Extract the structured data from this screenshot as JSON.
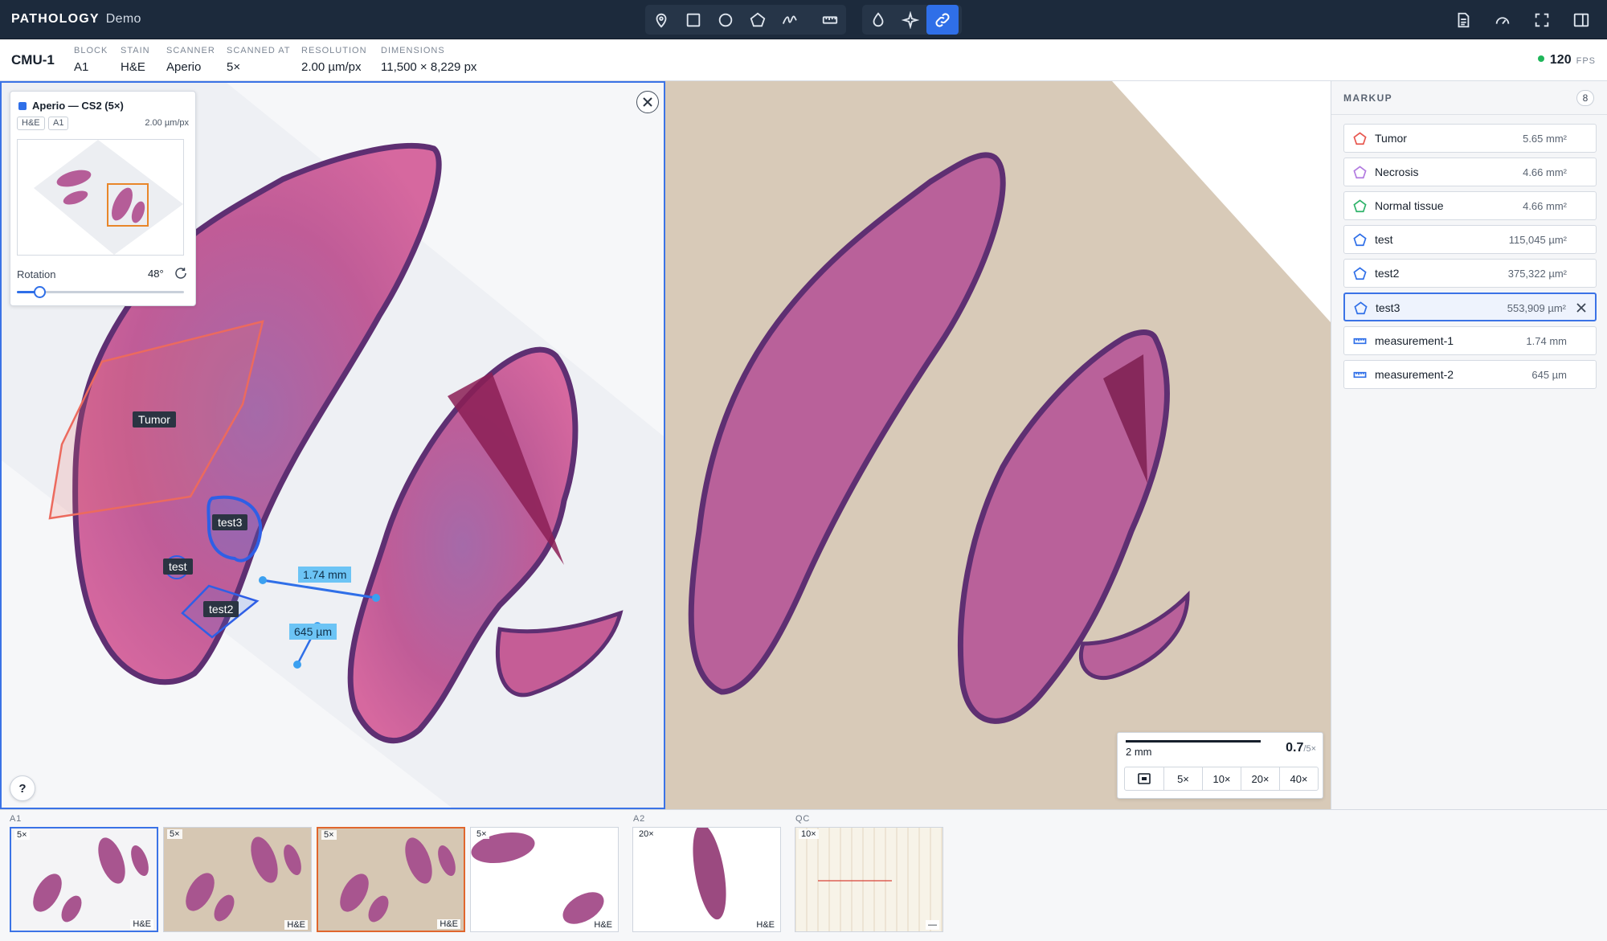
{
  "app": {
    "brand": "PATHOLOGY",
    "mode": "Demo"
  },
  "toolbar": {
    "tools": [
      {
        "name": "pin-tool",
        "icon": "map-pin-icon"
      },
      {
        "name": "rectangle-tool",
        "icon": "square-icon"
      },
      {
        "name": "ellipse-tool",
        "icon": "circle-icon"
      },
      {
        "name": "polygon-tool",
        "icon": "pentagon-icon"
      },
      {
        "name": "freehand-tool",
        "icon": "freehand-icon"
      },
      {
        "name": "ruler-tool",
        "icon": "ruler-icon"
      },
      {
        "name": "stain-tool",
        "icon": "droplet-icon"
      },
      {
        "name": "ai-tool",
        "icon": "sparkle-icon"
      },
      {
        "name": "link-tool",
        "icon": "link-icon",
        "active": true
      }
    ],
    "right": [
      "report-icon",
      "gauge-icon",
      "fullscreen-icon",
      "sidebar-icon"
    ]
  },
  "slide": {
    "id": "CMU-1",
    "meta": [
      {
        "key": "BLOCK",
        "value": "A1"
      },
      {
        "key": "STAIN",
        "value": "H&E"
      },
      {
        "key": "SCANNER",
        "value": "Aperio"
      },
      {
        "key": "SCANNED AT",
        "value": "5×"
      },
      {
        "key": "RESOLUTION",
        "value": "2.00 µm/px"
      },
      {
        "key": "DIMENSIONS",
        "value": "11,500 × 8,229 px"
      }
    ]
  },
  "fps": {
    "value": "120",
    "unit": "FPS"
  },
  "slide_panel": {
    "title": "Aperio — CS2 (5×)",
    "chips": [
      "H&E",
      "A1"
    ],
    "resolution": "2.00 µm/px",
    "rotation_label": "Rotation",
    "rotation_value": "48°",
    "rotation_fraction": 0.133
  },
  "annotations": {
    "tumor": "Tumor",
    "test3": "test3",
    "test": "test",
    "test2": "test2",
    "meas1": "1.74 mm",
    "meas2": "645 µm"
  },
  "help_label": "?",
  "scalebar": {
    "length": "2 mm",
    "magnification": "0.7",
    "native": "/5×",
    "zoom_buttons": [
      "5×",
      "10×",
      "20×",
      "40×"
    ]
  },
  "markup": {
    "title": "MARKUP",
    "count": "8",
    "items": [
      {
        "name": "Tumor",
        "value": "5.65 mm²",
        "icon": "polygon-icon",
        "color": "#e8574f"
      },
      {
        "name": "Necrosis",
        "value": "4.66 mm²",
        "icon": "polygon-icon",
        "color": "#b27be0"
      },
      {
        "name": "Normal tissue",
        "value": "4.66 mm²",
        "icon": "polygon-icon",
        "color": "#2fb36a"
      },
      {
        "name": "test",
        "value": "115,045 µm²",
        "icon": "polygon-icon",
        "color": "#2f6fe8"
      },
      {
        "name": "test2",
        "value": "375,322 µm²",
        "icon": "polygon-icon",
        "color": "#2f6fe8"
      },
      {
        "name": "test3",
        "value": "553,909 µm²",
        "icon": "polygon-icon",
        "color": "#2f6fe8",
        "selected": true
      },
      {
        "name": "measurement-1",
        "value": "1.74 mm",
        "icon": "ruler-icon",
        "color": "#2f6fe8"
      },
      {
        "name": "measurement-2",
        "value": "645 µm",
        "icon": "ruler-icon",
        "color": "#2f6fe8"
      }
    ]
  },
  "filmstrip": {
    "groups": [
      "A1",
      "A2",
      "QC"
    ],
    "thumbs": [
      {
        "mag": "5×",
        "stain": "H&E",
        "state": "selected"
      },
      {
        "mag": "5×",
        "stain": "H&E",
        "state": ""
      },
      {
        "mag": "5×",
        "stain": "H&E",
        "state": "active-orange"
      },
      {
        "mag": "5×",
        "stain": "H&E",
        "state": ""
      },
      {
        "mag": "20×",
        "stain": "H&E",
        "state": ""
      },
      {
        "mag": "10×",
        "stain": "—",
        "state": ""
      }
    ]
  },
  "colors": {
    "accent": "#2f6fe8",
    "topbar": "#1c2a3c",
    "tissue": "#c2538f",
    "tissue_dark": "#6c3a7e",
    "tumor": "#e8574f"
  }
}
